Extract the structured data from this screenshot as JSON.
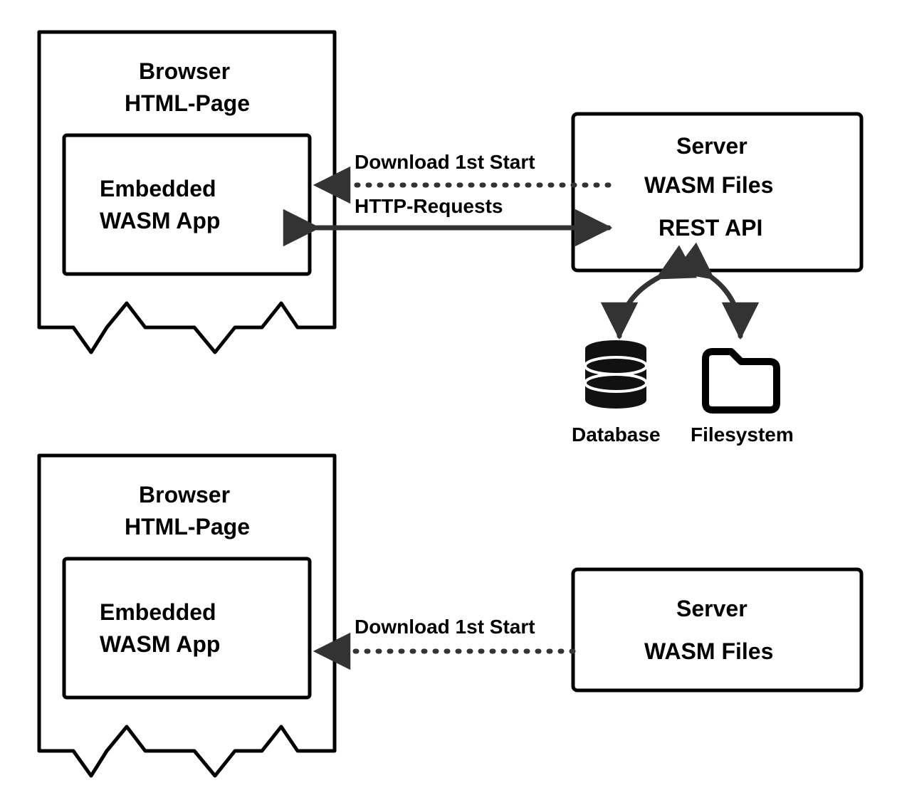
{
  "top": {
    "browser": {
      "title_line1": "Browser",
      "title_line2": "HTML-Page",
      "inner_line1": "Embedded",
      "inner_line2": "WASM App"
    },
    "server": {
      "title": "Server",
      "line2": "WASM Files",
      "line3": "REST API"
    },
    "arrows": {
      "download_label": "Download 1st Start",
      "http_label": "HTTP-Requests"
    },
    "backends": {
      "db_label": "Database",
      "fs_label": "Filesystem"
    }
  },
  "bottom": {
    "browser": {
      "title_line1": "Browser",
      "title_line2": "HTML-Page",
      "inner_line1": "Embedded",
      "inner_line2": "WASM App"
    },
    "server": {
      "title": "Server",
      "line2": "WASM Files"
    },
    "arrows": {
      "download_label": "Download 1st Start"
    }
  }
}
